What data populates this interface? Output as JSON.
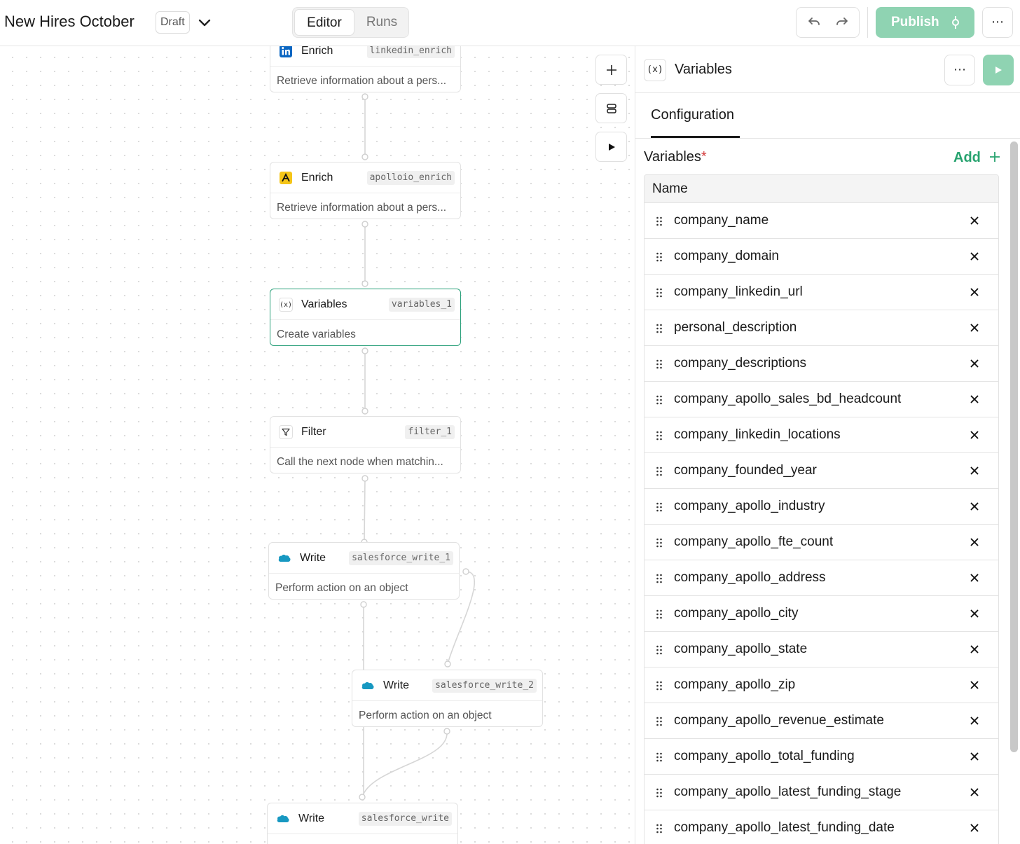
{
  "header": {
    "title": "New Hires October",
    "status": "Draft",
    "tabs": [
      {
        "label": "Editor",
        "active": true
      },
      {
        "label": "Runs",
        "active": false
      }
    ],
    "publish_label": "Publish",
    "accent_color": "#8fd3b2"
  },
  "canvas": {
    "nodes": [
      {
        "title": "Enrich",
        "tag": "linkedin_enrich",
        "desc": "Retrieve information about a pers...",
        "icon": "linkedin-icon"
      },
      {
        "title": "Enrich",
        "tag": "apolloio_enrich",
        "desc": "Retrieve information about a pers...",
        "icon": "apollo-icon"
      },
      {
        "title": "Variables",
        "tag": "variables_1",
        "desc": "Create variables",
        "icon": "variables-icon",
        "icon_text": "(x)",
        "selected": true
      },
      {
        "title": "Filter",
        "tag": "filter_1",
        "desc": "Call the next node when matchin...",
        "icon": "filter-icon"
      },
      {
        "title": "Write",
        "tag": "salesforce_write_1",
        "desc": "Perform action on an object",
        "icon": "salesforce-icon"
      },
      {
        "title": "Write",
        "tag": "salesforce_write_2",
        "desc": "Perform action on an object",
        "icon": "salesforce-icon"
      },
      {
        "title": "Write",
        "tag": "salesforce_write",
        "desc": "",
        "icon": "salesforce-icon"
      }
    ]
  },
  "panel": {
    "icon_text": "(x)",
    "title": "Variables",
    "tab": "Configuration",
    "section_label": "Variables",
    "required_mark": "*",
    "add_label": "Add",
    "column_header": "Name",
    "variables": [
      "company_name",
      "company_domain",
      "company_linkedin_url",
      "personal_description",
      "company_descriptions",
      "company_apollo_sales_bd_headcount",
      "company_linkedin_locations",
      "company_founded_year",
      "company_apollo_industry",
      "company_apollo_fte_count",
      "company_apollo_address",
      "company_apollo_city",
      "company_apollo_state",
      "company_apollo_zip",
      "company_apollo_revenue_estimate",
      "company_apollo_total_funding",
      "company_apollo_latest_funding_stage",
      "company_apollo_latest_funding_date"
    ]
  }
}
